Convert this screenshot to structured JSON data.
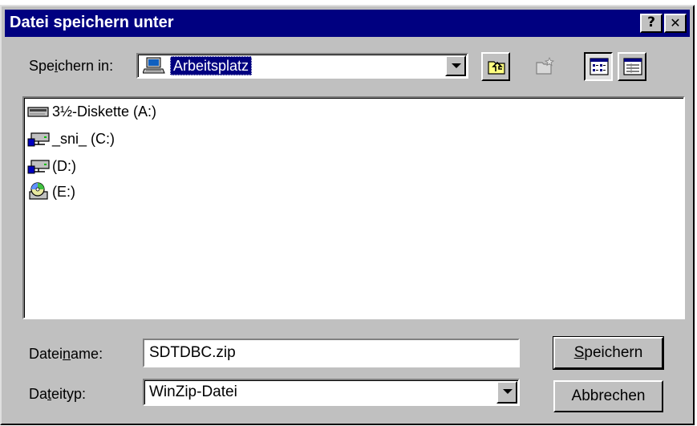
{
  "dialog": {
    "title": "Datei speichern unter",
    "help_label": "?",
    "close_label": "✕"
  },
  "location": {
    "label_pre": "Spe",
    "label_ul": "i",
    "label_post": "chern in:",
    "value": "Arbeitsplatz",
    "value_icon": "computer-icon"
  },
  "toolbar": {
    "buttons": [
      {
        "name": "up-one-level",
        "icon": "folder-up-icon"
      },
      {
        "name": "new-folder",
        "icon": "new-folder-icon"
      },
      {
        "name": "list-view",
        "icon": "list-view-icon"
      },
      {
        "name": "details-view",
        "icon": "details-view-icon"
      }
    ]
  },
  "files": [
    {
      "label": "3½-Diskette (A:)",
      "icon": "floppy-drive-icon"
    },
    {
      "label": "_sni_ (C:)",
      "icon": "network-drive-icon"
    },
    {
      "label": "(D:)",
      "icon": "network-drive-icon"
    },
    {
      "label": "(E:)",
      "icon": "cd-drive-icon"
    }
  ],
  "filename": {
    "label_pre": "Datei",
    "label_ul": "n",
    "label_post": "ame:",
    "value": "SDTDBC.zip"
  },
  "filetype": {
    "label_pre": "Da",
    "label_ul": "t",
    "label_post": "eityp:",
    "value": "WinZip-Datei"
  },
  "buttons": {
    "save_ul": "S",
    "save_rest": "peichern",
    "cancel": "Abbrechen"
  },
  "colors": {
    "titlebar": "#000080",
    "face": "#c0c0c0",
    "selection": "#000080"
  }
}
